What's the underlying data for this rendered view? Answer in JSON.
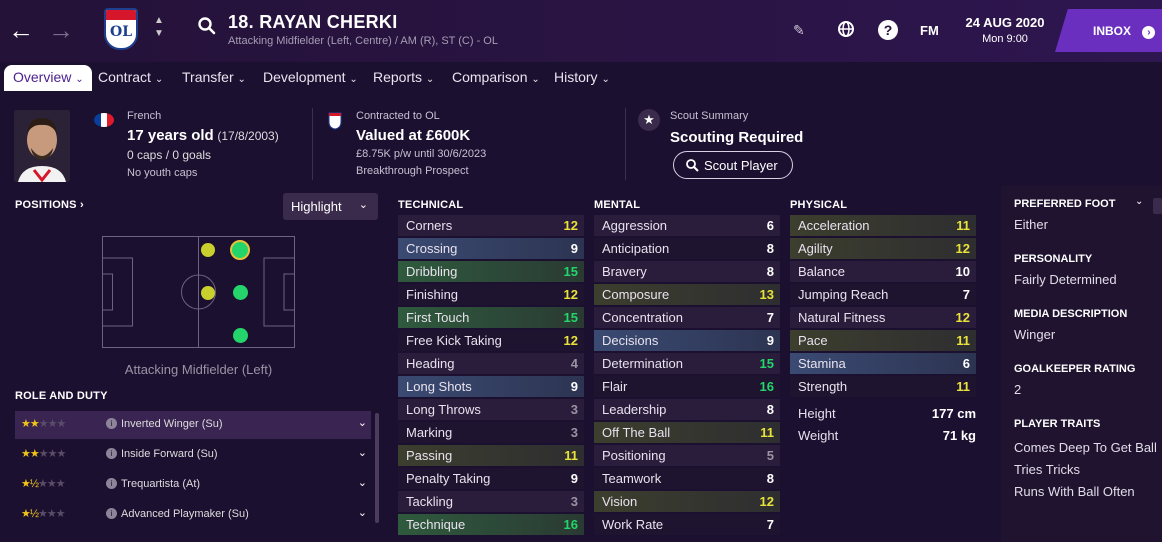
{
  "header": {
    "player_name": "18. RAYAN CHERKI",
    "player_positions": "Attacking Midfielder (Left, Centre) / AM (R), ST (C) - OL",
    "club_crest_text": "OL",
    "date": "24 AUG 2020",
    "time": "Mon 9:00",
    "fm_label": "FM",
    "inbox_label": "INBOX"
  },
  "menu": [
    "Overview",
    "Contract",
    "Transfer",
    "Development",
    "Reports",
    "Comparison",
    "History"
  ],
  "info": {
    "nationality": "French",
    "age": "17 years old",
    "dob": "(17/8/2003)",
    "caps": "0 caps / 0 goals",
    "youth_caps": "No youth caps",
    "contract_club": "Contracted to OL",
    "value": "Valued at £600K",
    "wage": "£8.75K p/w until 30/6/2023",
    "status": "Breakthrough Prospect",
    "scout_title": "Scout Summary",
    "scout_status": "Scouting Required",
    "scout_button": "Scout Player"
  },
  "positions": {
    "title": "POSITIONS",
    "highlight_label": "Highlight",
    "position_caption": "Attacking Midfielder (Left)"
  },
  "roles": {
    "title": "ROLE AND DUTY",
    "items": [
      {
        "name": "Inverted Winger (Su)",
        "stars": 2.0
      },
      {
        "name": "Inside Forward (Su)",
        "stars": 2.0
      },
      {
        "name": "Trequartista (At)",
        "stars": 1.5
      },
      {
        "name": "Advanced Playmaker (Su)",
        "stars": 1.5
      }
    ]
  },
  "technical": {
    "title": "TECHNICAL",
    "rows": [
      {
        "label": "Corners",
        "value": "12"
      },
      {
        "label": "Crossing",
        "value": "9"
      },
      {
        "label": "Dribbling",
        "value": "15"
      },
      {
        "label": "Finishing",
        "value": "12"
      },
      {
        "label": "First Touch",
        "value": "15"
      },
      {
        "label": "Free Kick Taking",
        "value": "12"
      },
      {
        "label": "Heading",
        "value": "4"
      },
      {
        "label": "Long Shots",
        "value": "9"
      },
      {
        "label": "Long Throws",
        "value": "3"
      },
      {
        "label": "Marking",
        "value": "3"
      },
      {
        "label": "Passing",
        "value": "11"
      },
      {
        "label": "Penalty Taking",
        "value": "9"
      },
      {
        "label": "Tackling",
        "value": "3"
      },
      {
        "label": "Technique",
        "value": "16"
      }
    ]
  },
  "mental": {
    "title": "MENTAL",
    "rows": [
      {
        "label": "Aggression",
        "value": "6"
      },
      {
        "label": "Anticipation",
        "value": "8"
      },
      {
        "label": "Bravery",
        "value": "8"
      },
      {
        "label": "Composure",
        "value": "13"
      },
      {
        "label": "Concentration",
        "value": "7"
      },
      {
        "label": "Decisions",
        "value": "9"
      },
      {
        "label": "Determination",
        "value": "15"
      },
      {
        "label": "Flair",
        "value": "16"
      },
      {
        "label": "Leadership",
        "value": "8"
      },
      {
        "label": "Off The Ball",
        "value": "11"
      },
      {
        "label": "Positioning",
        "value": "5"
      },
      {
        "label": "Teamwork",
        "value": "8"
      },
      {
        "label": "Vision",
        "value": "12"
      },
      {
        "label": "Work Rate",
        "value": "7"
      }
    ]
  },
  "physical": {
    "title": "PHYSICAL",
    "rows": [
      {
        "label": "Acceleration",
        "value": "11"
      },
      {
        "label": "Agility",
        "value": "12"
      },
      {
        "label": "Balance",
        "value": "10"
      },
      {
        "label": "Jumping Reach",
        "value": "7"
      },
      {
        "label": "Natural Fitness",
        "value": "12"
      },
      {
        "label": "Pace",
        "value": "11"
      },
      {
        "label": "Stamina",
        "value": "6"
      },
      {
        "label": "Strength",
        "value": "11"
      }
    ],
    "height_label": "Height",
    "height_value": "177 cm",
    "weight_label": "Weight",
    "weight_value": "71 kg"
  },
  "side": {
    "foot_title": "PREFERRED FOOT",
    "foot_value": "Either",
    "personality_title": "PERSONALITY",
    "personality_value": "Fairly Determined",
    "media_title": "MEDIA DESCRIPTION",
    "media_value": "Winger",
    "gk_title": "GOALKEEPER RATING",
    "gk_value": "2",
    "traits_title": "PLAYER TRAITS",
    "traits": [
      "Comes Deep To Get Ball",
      "Tries Tricks",
      "Runs With Ball Often"
    ]
  },
  "colors": {
    "high": "#23d56a",
    "good": "#e8e23a",
    "mid": "#ffffff",
    "low": "#9a93a4",
    "accent": "#6b2fc0"
  }
}
